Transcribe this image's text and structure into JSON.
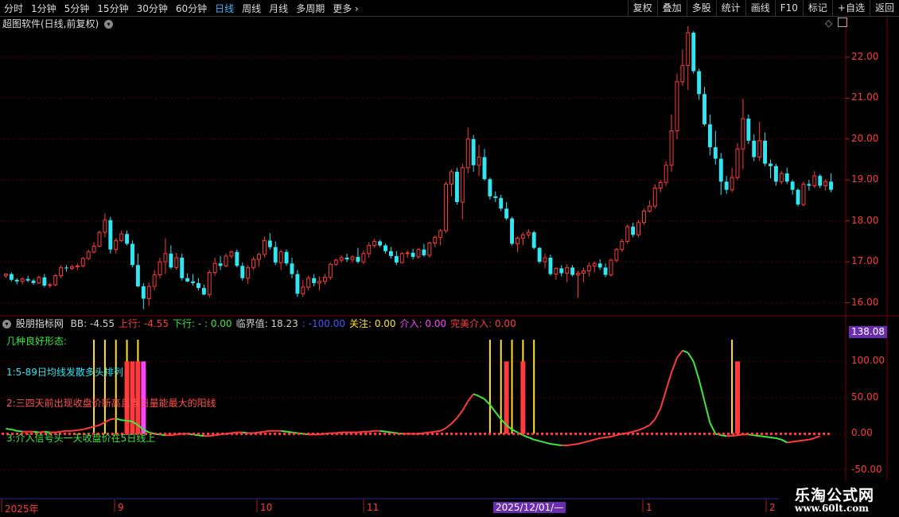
{
  "toolbar": {
    "timeframes": [
      {
        "label": "分时",
        "active": false
      },
      {
        "label": "1分钟",
        "active": false
      },
      {
        "label": "5分钟",
        "active": false
      },
      {
        "label": "15分钟",
        "active": false
      },
      {
        "label": "30分钟",
        "active": false
      },
      {
        "label": "60分钟",
        "active": false
      },
      {
        "label": "日线",
        "active": true
      },
      {
        "label": "周线",
        "active": false
      },
      {
        "label": "月线",
        "active": false
      },
      {
        "label": "多周期",
        "active": false
      },
      {
        "label": "更多 ›",
        "active": false
      }
    ],
    "right_buttons": [
      "复权",
      "叠加",
      "多股",
      "统计",
      "画线",
      "F10",
      "标记",
      "+自选",
      "返回"
    ]
  },
  "main_panel": {
    "title": "超图软件(日线,前复权)",
    "price_axis": [
      "22.00",
      "21.00",
      "20.00",
      "19.00",
      "18.00",
      "17.00",
      "16.00"
    ]
  },
  "indicator_panel": {
    "name": "股朋指标网",
    "readouts": [
      {
        "text": "BB: -4.55",
        "color": "#d0d0d0"
      },
      {
        "text": "上行: -4.55",
        "color": "#ff3b3b"
      },
      {
        "text": "下行: -  : 0.00",
        "color": "#3ee83e"
      },
      {
        "text": "临界值: 18.23",
        "color": "#d0d0d0"
      },
      {
        "text": ": -100.00",
        "color": "#3b5bff"
      },
      {
        "text": "关注: 0.00",
        "color": "#ffe135"
      },
      {
        "text": "介入: 0.00",
        "color": "#ff44ff"
      },
      {
        "text": "完美介入: 0.00",
        "color": "#ff3b3b"
      }
    ],
    "notes": [
      {
        "text": "几种良好形态:",
        "color": "#3ee83e"
      },
      {
        "text": "1:5-89日均线发散多头排列",
        "color": "#31e6f2"
      },
      {
        "text": "2:三四天前出现收盘价新高且当日量能最大的阳线",
        "color": "#ff5050"
      },
      {
        "text": "3:介入信号头一天收盘价在5日线上",
        "color": "#3ee83e"
      }
    ],
    "axis": [
      "100.00",
      "50.00",
      "0.00",
      "-50.00"
    ],
    "current_value": "138.08"
  },
  "time_axis": {
    "labels": [
      "2025年",
      "9",
      "10",
      "11",
      "1",
      "2"
    ],
    "cursor_label": "2025/12/01/—"
  },
  "watermark": {
    "line1": "乐淘公式网",
    "line2": "www.60lt.com"
  },
  "colors": {
    "up": "#ff3b3b",
    "down": "#31e6f2",
    "bg": "#000000",
    "grid": "#5a0000",
    "attention": "#ffe135",
    "entry": "#ff44ff"
  },
  "chart_data": {
    "type": "candlestick",
    "ylim": [
      15.7,
      22.7
    ],
    "candles": [
      [
        16.66,
        16.72,
        16.6,
        16.7
      ],
      [
        16.7,
        16.74,
        16.52,
        16.56
      ],
      [
        16.56,
        16.6,
        16.45,
        16.52
      ],
      [
        16.52,
        16.62,
        16.45,
        16.58
      ],
      [
        16.58,
        16.66,
        16.5,
        16.54
      ],
      [
        16.54,
        16.58,
        16.44,
        16.48
      ],
      [
        16.48,
        16.66,
        16.46,
        16.62
      ],
      [
        16.62,
        16.7,
        16.38,
        16.42
      ],
      [
        16.42,
        16.48,
        16.36,
        16.44
      ],
      [
        16.44,
        16.7,
        16.4,
        16.66
      ],
      [
        16.66,
        16.92,
        16.6,
        16.86
      ],
      [
        16.86,
        16.92,
        16.76,
        16.84
      ],
      [
        16.84,
        16.92,
        16.8,
        16.88
      ],
      [
        16.88,
        16.96,
        16.8,
        16.9
      ],
      [
        16.9,
        17.12,
        16.86,
        17.08
      ],
      [
        17.08,
        17.3,
        17.04,
        17.24
      ],
      [
        17.24,
        17.48,
        17.2,
        17.38
      ],
      [
        17.38,
        17.76,
        17.36,
        17.72
      ],
      [
        17.72,
        18.18,
        17.6,
        18.02
      ],
      [
        18.02,
        18.1,
        17.2,
        17.3
      ],
      [
        17.3,
        17.58,
        17.2,
        17.52
      ],
      [
        17.52,
        17.76,
        17.48,
        17.68
      ],
      [
        17.68,
        17.76,
        17.4,
        17.44
      ],
      [
        17.44,
        17.52,
        16.86,
        16.92
      ],
      [
        16.92,
        17.2,
        16.38,
        16.4
      ],
      [
        16.4,
        16.48,
        15.84,
        16.1
      ],
      [
        16.1,
        16.5,
        15.92,
        16.4
      ],
      [
        16.4,
        16.8,
        16.3,
        16.68
      ],
      [
        16.68,
        17.1,
        16.6,
        17.0
      ],
      [
        17.0,
        17.58,
        16.7,
        17.2
      ],
      [
        17.2,
        17.4,
        16.82,
        16.86
      ],
      [
        16.86,
        17.22,
        16.8,
        17.1
      ],
      [
        17.1,
        17.2,
        16.54,
        16.6
      ],
      [
        16.6,
        16.72,
        16.5,
        16.52
      ],
      [
        16.52,
        16.7,
        16.42,
        16.48
      ],
      [
        16.48,
        16.6,
        16.3,
        16.36
      ],
      [
        16.36,
        16.44,
        16.18,
        16.2
      ],
      [
        16.2,
        16.8,
        16.12,
        16.74
      ],
      [
        16.74,
        17.1,
        16.66,
        16.96
      ],
      [
        16.96,
        17.14,
        16.8,
        16.9
      ],
      [
        16.9,
        17.2,
        16.86,
        17.14
      ],
      [
        17.14,
        17.28,
        17.08,
        17.24
      ],
      [
        17.24,
        17.3,
        16.86,
        16.9
      ],
      [
        16.9,
        16.98,
        16.54,
        16.6
      ],
      [
        16.6,
        16.92,
        16.46,
        16.86
      ],
      [
        16.86,
        17.12,
        16.8,
        17.06
      ],
      [
        17.06,
        17.22,
        16.88,
        17.18
      ],
      [
        17.18,
        17.62,
        17.1,
        17.52
      ],
      [
        17.52,
        17.7,
        17.3,
        17.36
      ],
      [
        17.36,
        17.5,
        16.92,
        16.98
      ],
      [
        16.98,
        17.3,
        16.8,
        17.24
      ],
      [
        17.24,
        17.3,
        16.9,
        16.96
      ],
      [
        16.96,
        17.1,
        16.6,
        16.7
      ],
      [
        16.7,
        16.8,
        16.14,
        16.22
      ],
      [
        16.22,
        16.56,
        16.14,
        16.38
      ],
      [
        16.38,
        16.66,
        16.3,
        16.6
      ],
      [
        16.6,
        16.7,
        16.4,
        16.48
      ],
      [
        16.48,
        16.64,
        16.3,
        16.52
      ],
      [
        16.52,
        16.7,
        16.44,
        16.62
      ],
      [
        16.62,
        16.98,
        16.56,
        16.94
      ],
      [
        16.94,
        17.08,
        16.9,
        17.04
      ],
      [
        17.04,
        17.16,
        16.98,
        17.1
      ],
      [
        17.1,
        17.2,
        17.0,
        17.06
      ],
      [
        17.06,
        17.16,
        16.98,
        17.12
      ],
      [
        17.12,
        17.34,
        16.96,
        17.0
      ],
      [
        17.0,
        17.28,
        16.94,
        17.2
      ],
      [
        17.2,
        17.48,
        17.1,
        17.4
      ],
      [
        17.4,
        17.56,
        17.34,
        17.5
      ],
      [
        17.5,
        17.54,
        17.36,
        17.4
      ],
      [
        17.4,
        17.44,
        17.2,
        17.26
      ],
      [
        17.26,
        17.36,
        17.08,
        17.14
      ],
      [
        17.14,
        17.26,
        16.92,
        16.98
      ],
      [
        16.98,
        17.24,
        16.96,
        17.2
      ],
      [
        17.2,
        17.28,
        17.1,
        17.22
      ],
      [
        17.22,
        17.32,
        17.06,
        17.12
      ],
      [
        17.12,
        17.34,
        17.08,
        17.3
      ],
      [
        17.3,
        17.44,
        17.12,
        17.16
      ],
      [
        17.16,
        17.5,
        17.1,
        17.46
      ],
      [
        17.46,
        17.64,
        17.36,
        17.6
      ],
      [
        17.6,
        17.8,
        17.4,
        17.76
      ],
      [
        17.76,
        18.96,
        17.7,
        18.9
      ],
      [
        18.9,
        19.26,
        18.6,
        19.2
      ],
      [
        19.2,
        19.3,
        18.4,
        18.46
      ],
      [
        18.46,
        19.4,
        18.04,
        19.3
      ],
      [
        19.3,
        20.28,
        19.16,
        20.0
      ],
      [
        20.0,
        20.1,
        19.2,
        19.36
      ],
      [
        19.36,
        19.86,
        19.1,
        19.56
      ],
      [
        19.56,
        19.76,
        18.98,
        19.02
      ],
      [
        19.02,
        19.06,
        18.52,
        18.6
      ],
      [
        18.6,
        18.72,
        18.46,
        18.56
      ],
      [
        18.56,
        18.64,
        18.24,
        18.3
      ],
      [
        18.3,
        18.46,
        18.02,
        18.06
      ],
      [
        18.06,
        18.1,
        17.4,
        17.44
      ],
      [
        17.44,
        17.62,
        17.24,
        17.58
      ],
      [
        17.58,
        17.72,
        17.4,
        17.66
      ],
      [
        17.66,
        17.8,
        17.58,
        17.72
      ],
      [
        17.72,
        17.76,
        17.3,
        17.34
      ],
      [
        17.34,
        17.36,
        16.96,
        17.0
      ],
      [
        17.0,
        17.2,
        16.84,
        17.1
      ],
      [
        17.1,
        17.18,
        16.66,
        16.7
      ],
      [
        16.7,
        16.86,
        16.56,
        16.84
      ],
      [
        16.84,
        16.92,
        16.64,
        16.72
      ],
      [
        16.72,
        16.94,
        16.5,
        16.86
      ],
      [
        16.86,
        16.92,
        16.64,
        16.68
      ],
      [
        16.68,
        16.78,
        16.12,
        16.72
      ],
      [
        16.72,
        16.86,
        16.5,
        16.78
      ],
      [
        16.78,
        16.98,
        16.64,
        16.9
      ],
      [
        16.9,
        17.0,
        16.74,
        16.96
      ],
      [
        16.96,
        17.06,
        16.8,
        16.86
      ],
      [
        16.86,
        16.96,
        16.62,
        16.68
      ],
      [
        16.68,
        17.08,
        16.64,
        17.04
      ],
      [
        17.04,
        17.34,
        16.98,
        17.3
      ],
      [
        17.3,
        17.56,
        17.24,
        17.5
      ],
      [
        17.5,
        17.92,
        17.44,
        17.86
      ],
      [
        17.86,
        17.96,
        17.6,
        17.66
      ],
      [
        17.66,
        18.02,
        17.6,
        17.96
      ],
      [
        17.96,
        18.3,
        17.9,
        18.24
      ],
      [
        18.24,
        18.5,
        18.2,
        18.36
      ],
      [
        18.36,
        18.9,
        18.3,
        18.8
      ],
      [
        18.8,
        19.0,
        18.7,
        18.94
      ],
      [
        18.94,
        19.46,
        18.86,
        19.36
      ],
      [
        19.36,
        20.6,
        19.2,
        20.2
      ],
      [
        20.2,
        21.6,
        20.0,
        21.4
      ],
      [
        21.4,
        22.2,
        21.3,
        21.8
      ],
      [
        21.8,
        22.76,
        21.2,
        22.6
      ],
      [
        22.6,
        22.64,
        21.6,
        21.66
      ],
      [
        21.66,
        21.72,
        20.96,
        21.1
      ],
      [
        21.1,
        21.28,
        20.32,
        20.36
      ],
      [
        20.36,
        20.6,
        19.6,
        19.8
      ],
      [
        19.8,
        20.2,
        19.38,
        19.52
      ],
      [
        19.52,
        19.66,
        18.64,
        18.96
      ],
      [
        18.96,
        19.1,
        18.66,
        18.76
      ],
      [
        18.76,
        19.3,
        18.7,
        19.06
      ],
      [
        19.06,
        19.9,
        19.0,
        19.76
      ],
      [
        19.76,
        20.98,
        19.26,
        20.5
      ],
      [
        20.5,
        20.6,
        19.88,
        19.96
      ],
      [
        19.96,
        20.12,
        19.46,
        19.56
      ],
      [
        19.56,
        20.42,
        19.46,
        19.96
      ],
      [
        19.96,
        20.16,
        19.34,
        19.4
      ],
      [
        19.4,
        19.5,
        19.04,
        19.34
      ],
      [
        19.34,
        19.4,
        18.86,
        18.96
      ],
      [
        18.96,
        19.22,
        18.9,
        19.16
      ],
      [
        19.16,
        19.3,
        18.9,
        18.96
      ],
      [
        18.96,
        19.0,
        18.64,
        18.76
      ],
      [
        18.76,
        18.8,
        18.36,
        18.4
      ],
      [
        18.4,
        18.96,
        18.36,
        18.9
      ],
      [
        18.9,
        19.0,
        18.74,
        18.86
      ],
      [
        18.86,
        19.22,
        18.8,
        19.1
      ],
      [
        19.1,
        19.14,
        18.8,
        18.86
      ],
      [
        18.86,
        19.02,
        18.74,
        18.96
      ],
      [
        18.96,
        19.16,
        18.7,
        18.76
      ]
    ],
    "indicator": {
      "ylim": [
        -60,
        140
      ],
      "line": [
        7,
        6,
        4,
        3,
        3,
        3,
        2,
        3,
        2,
        2,
        3,
        4,
        4,
        5,
        6,
        8,
        10,
        12,
        16,
        20,
        21,
        19,
        18,
        17,
        12,
        6,
        2,
        0,
        -1,
        -2,
        -2,
        -1,
        0,
        0,
        -1,
        -2,
        -3,
        -3,
        -2,
        -1,
        0,
        1,
        2,
        2,
        1,
        1,
        2,
        3,
        4,
        4,
        4,
        3,
        2,
        1,
        0,
        -1,
        -1,
        -1,
        0,
        1,
        1,
        2,
        2,
        2,
        2,
        3,
        3,
        4,
        4,
        3,
        2,
        1,
        0,
        0,
        0,
        0,
        1,
        2,
        3,
        4,
        8,
        14,
        22,
        32,
        45,
        55,
        52,
        48,
        40,
        30,
        20,
        12,
        6,
        2,
        -2,
        -5,
        -8,
        -10,
        -12,
        -14,
        -15,
        -16,
        -16,
        -15,
        -14,
        -12,
        -10,
        -8,
        -6,
        -5,
        -4,
        -2,
        0,
        1,
        3,
        5,
        8,
        12,
        20,
        35,
        60,
        85,
        105,
        115,
        112,
        100,
        75,
        45,
        15,
        0,
        -2,
        -3,
        -3,
        -2,
        -1,
        -1,
        -2,
        -3,
        -4,
        -5,
        -6,
        -8,
        -12,
        -11,
        -10,
        -9,
        -8,
        -6,
        -3
      ],
      "attention_bars": [
        16,
        18,
        20,
        22,
        24,
        88,
        90,
        92,
        94,
        96,
        132
      ],
      "perfect_entry_bars": [
        22,
        23,
        24,
        91,
        94,
        133
      ],
      "entry_bars": [
        25
      ]
    }
  }
}
